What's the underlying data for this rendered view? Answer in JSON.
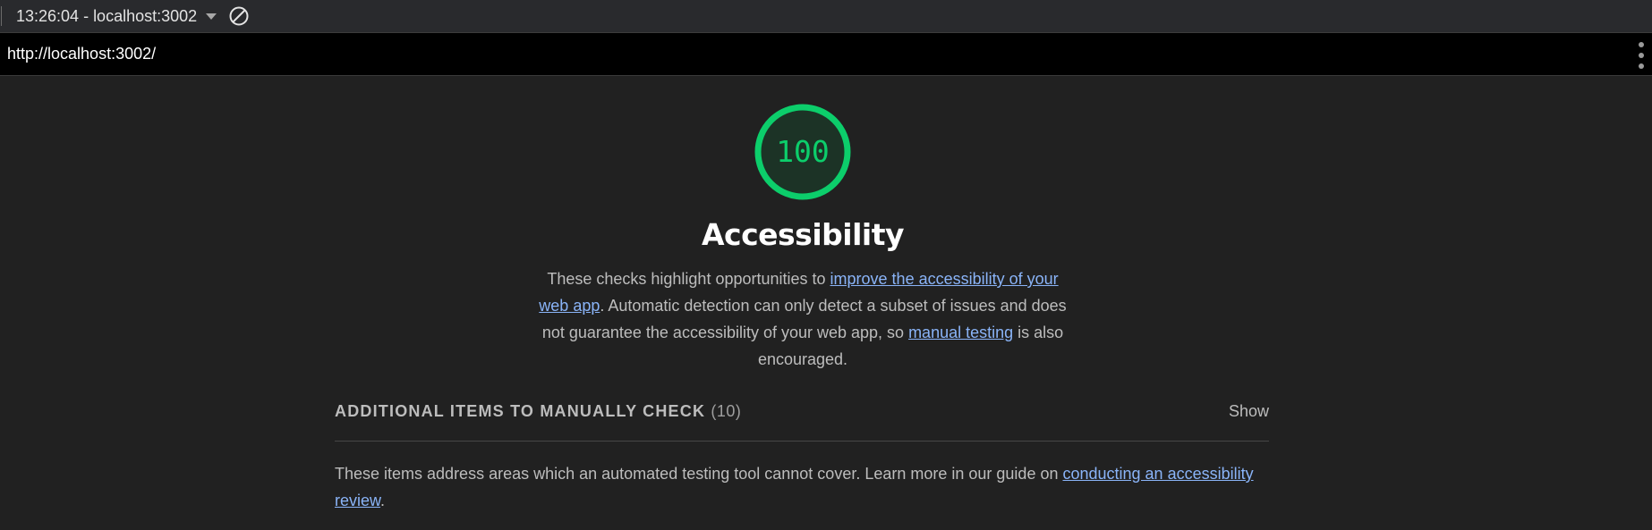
{
  "toolbar": {
    "report_label": "13:26:04 - localhost:3002"
  },
  "url": "http://localhost:3002/",
  "gauge": {
    "score": "100",
    "color": "#0cce6b"
  },
  "category": {
    "title": "Accessibility",
    "desc_part1": "These checks highlight opportunities to ",
    "desc_link1": "improve the accessibility of your web app",
    "desc_part2": ". Automatic detection can only detect a subset of issues and does not guarantee the accessibility of your web app, so ",
    "desc_link2": "manual testing",
    "desc_part3": " is also encouraged."
  },
  "manual_group": {
    "title": "ADDITIONAL ITEMS TO MANUALLY CHECK",
    "count": "(10)",
    "toggle_label": "Show",
    "desc_text": "These items address areas which an automated testing tool cannot cover. Learn more in our guide on ",
    "desc_link": "conducting an accessibility review",
    "desc_end": "."
  }
}
